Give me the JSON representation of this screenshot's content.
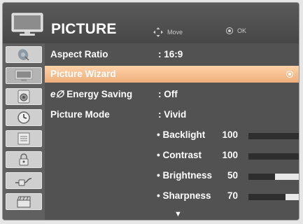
{
  "header": {
    "title": "PICTURE",
    "hint_move": "Move",
    "hint_ok": "OK"
  },
  "sidebar": {
    "items": [
      {
        "icon": "satellite-dish-icon",
        "active": false
      },
      {
        "icon": "tv-picture-icon",
        "active": true
      },
      {
        "icon": "speaker-icon",
        "active": false
      },
      {
        "icon": "clock-icon",
        "active": false
      },
      {
        "icon": "options-list-icon",
        "active": false
      },
      {
        "icon": "lock-icon",
        "active": false
      },
      {
        "icon": "input-plug-icon",
        "active": false
      },
      {
        "icon": "clapperboard-icon",
        "active": false
      }
    ]
  },
  "menu": {
    "rows": [
      {
        "label": "Aspect Ratio",
        "value": ": 16:9"
      },
      {
        "label": "Picture Wizard",
        "value": ""
      },
      {
        "label": "Energy Saving",
        "value": ": Off"
      },
      {
        "label": "Picture Mode",
        "value": ": Vivid"
      }
    ],
    "energy_symbol": "e∅",
    "settings": [
      {
        "label": "• Backlight",
        "value": 100
      },
      {
        "label": "• Contrast",
        "value": 100
      },
      {
        "label": "• Brightness",
        "value": 50
      },
      {
        "label": "• Sharpness",
        "value": 70
      }
    ],
    "scroll_down": "▼"
  },
  "colors": {
    "selected_row": "#f4b889",
    "background": "#525252"
  }
}
